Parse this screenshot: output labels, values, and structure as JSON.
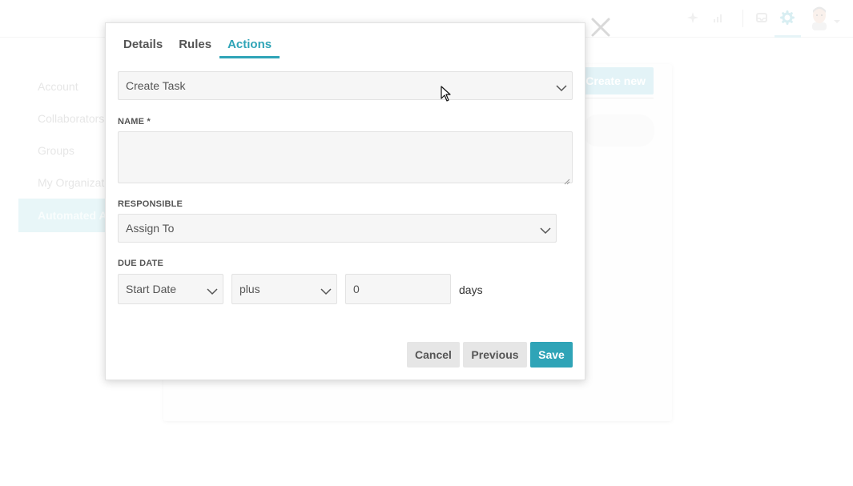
{
  "background": {
    "sidebar": {
      "items": [
        {
          "label": "Account"
        },
        {
          "label": "Collaborators"
        },
        {
          "label": "Groups"
        },
        {
          "label": "My Organization"
        },
        {
          "label": "Automated Actions"
        }
      ],
      "active_index": 4
    },
    "create_button": "Create new",
    "topbar_icons": [
      "star-icon",
      "stats-icon",
      "inbox-icon",
      "gear-icon",
      "avatar",
      "chevron-down-icon"
    ]
  },
  "modal": {
    "close_icon": "close-icon",
    "tabs": [
      {
        "label": "Details"
      },
      {
        "label": "Rules"
      },
      {
        "label": "Actions"
      }
    ],
    "active_tab": "Actions",
    "action_type": {
      "value": "Create Task"
    },
    "name": {
      "label": "NAME *",
      "value": ""
    },
    "responsible": {
      "label": "RESPONSIBLE",
      "value": "Assign To"
    },
    "due_date": {
      "label": "DUE DATE",
      "base": "Start Date",
      "operator": "plus",
      "amount": "0",
      "unit": "days"
    },
    "buttons": {
      "cancel": "Cancel",
      "previous": "Previous",
      "save": "Save"
    }
  },
  "colors": {
    "accent": "#2fa4b7",
    "field_bg": "#f6f6f6",
    "field_border": "#e2e2e2"
  }
}
